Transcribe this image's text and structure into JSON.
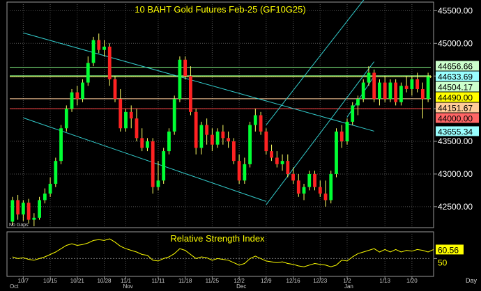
{
  "chart_data": {
    "type": "candlestick",
    "title": "10  BAHT  Gold  Futures  Feb-25  (GF10G25)",
    "indicator_title": "Relative  Strength  Index",
    "y_axis": {
      "range": [
        42200,
        45600
      ],
      "ticks": [
        {
          "value": 45500,
          "label": "45500.00"
        },
        {
          "value": 45000,
          "label": "45000.00"
        },
        {
          "value": 44500,
          "label": "44500.00"
        },
        {
          "value": 44000,
          "label": "44000.00"
        },
        {
          "value": 43500,
          "label": "43500.00"
        },
        {
          "value": 43000,
          "label": "43000.00"
        },
        {
          "value": 42500,
          "label": "42500.00"
        }
      ]
    },
    "price_tags": [
      {
        "value": 44656.66,
        "label": "44656.66",
        "bg": "#ccffcc",
        "fg": "#000000"
      },
      {
        "value": 44633.69,
        "label": "44633.69",
        "bg": "#99ffff",
        "fg": "#000000"
      },
      {
        "value": 44504.17,
        "label": "44504.17",
        "bg": "#ccffcc",
        "fg": "#000000"
      },
      {
        "value": 44490.0,
        "label": "44490.00",
        "bg": "#ffff00",
        "fg": "#000000"
      },
      {
        "value": 44151.67,
        "label": "44151.67",
        "bg": "#ffcc99",
        "fg": "#000000"
      },
      {
        "value": 44000.0,
        "label": "44000.00",
        "bg": "#ff6666",
        "fg": "#000000"
      },
      {
        "value": 43655.34,
        "label": "43655.34",
        "bg": "#99ffff",
        "fg": "#000000"
      }
    ],
    "horizontal_lines": [
      {
        "value": 44633.69,
        "color": "#88ff88"
      },
      {
        "value": 44504.17,
        "color": "#88ff88"
      },
      {
        "value": 44490.0,
        "color": "#ffff66"
      },
      {
        "value": 44151.67,
        "color": "#ffcc99"
      },
      {
        "value": 44000.0,
        "color": "#ff4444"
      }
    ],
    "trend_lines": [
      {
        "points": [
          [
            2,
            45160
          ],
          [
            67,
            43655.34
          ]
        ],
        "color": "#33cccc"
      },
      {
        "points": [
          [
            2,
            43860
          ],
          [
            47,
            42580
          ]
        ],
        "color": "#33cccc"
      },
      {
        "points": [
          [
            47,
            42530
          ],
          [
            67,
            44720
          ]
        ],
        "color": "#33cccc"
      },
      {
        "points": [
          [
            47,
            43750
          ],
          [
            67,
            45870
          ]
        ],
        "color": "#33cccc"
      },
      {
        "points": [
          [
            62,
            43870
          ],
          [
            67,
            44500
          ]
        ],
        "color": "#33cccc"
      }
    ],
    "bars": [
      {
        "date": "10/3",
        "o": 42270,
        "h": 42650,
        "l": 42220,
        "c": 42600
      },
      {
        "date": "10/4",
        "o": 42600,
        "h": 42680,
        "l": 42300,
        "c": 42380
      },
      {
        "date": "10/7",
        "o": 42380,
        "h": 42600,
        "l": 42280,
        "c": 42560
      },
      {
        "date": "10/8",
        "o": 42560,
        "h": 42620,
        "l": 42240,
        "c": 42300
      },
      {
        "date": "10/9",
        "o": 42300,
        "h": 42400,
        "l": 42200,
        "c": 42330
      },
      {
        "date": "10/10",
        "o": 42330,
        "h": 42650,
        "l": 42300,
        "c": 42600
      },
      {
        "date": "10/11",
        "o": 42600,
        "h": 42780,
        "l": 42550,
        "c": 42700
      },
      {
        "date": "10/14",
        "o": 42700,
        "h": 42950,
        "l": 42650,
        "c": 42850
      },
      {
        "date": "10/15",
        "o": 42850,
        "h": 43250,
        "l": 42800,
        "c": 43200
      },
      {
        "date": "10/16",
        "o": 43200,
        "h": 43750,
        "l": 43150,
        "c": 43700
      },
      {
        "date": "10/17",
        "o": 43700,
        "h": 44050,
        "l": 43650,
        "c": 44000
      },
      {
        "date": "10/18",
        "o": 44000,
        "h": 44300,
        "l": 43950,
        "c": 44250
      },
      {
        "date": "10/21",
        "o": 44250,
        "h": 44350,
        "l": 44050,
        "c": 44150
      },
      {
        "date": "10/22",
        "o": 44150,
        "h": 44450,
        "l": 44100,
        "c": 44400
      },
      {
        "date": "10/23",
        "o": 44400,
        "h": 44800,
        "l": 44350,
        "c": 44700
      },
      {
        "date": "10/24",
        "o": 44700,
        "h": 45100,
        "l": 44650,
        "c": 45050
      },
      {
        "date": "10/25",
        "o": 45050,
        "h": 45150,
        "l": 44850,
        "c": 44900
      },
      {
        "date": "10/28",
        "o": 44900,
        "h": 45050,
        "l": 44800,
        "c": 44950
      },
      {
        "date": "10/29",
        "o": 44950,
        "h": 45000,
        "l": 44350,
        "c": 44450
      },
      {
        "date": "10/30",
        "o": 44450,
        "h": 44500,
        "l": 44100,
        "c": 44150
      },
      {
        "date": "10/31",
        "o": 44150,
        "h": 44300,
        "l": 43650,
        "c": 43700
      },
      {
        "date": "11/1",
        "o": 43700,
        "h": 44000,
        "l": 43650,
        "c": 43950
      },
      {
        "date": "11/4",
        "o": 43950,
        "h": 44050,
        "l": 43700,
        "c": 43850
      },
      {
        "date": "11/5",
        "o": 43850,
        "h": 44000,
        "l": 43500,
        "c": 43550
      },
      {
        "date": "11/6",
        "o": 43550,
        "h": 43700,
        "l": 43350,
        "c": 43400
      },
      {
        "date": "11/7",
        "o": 43400,
        "h": 43550,
        "l": 43350,
        "c": 43500
      },
      {
        "date": "11/8",
        "o": 43500,
        "h": 43550,
        "l": 42700,
        "c": 42800
      },
      {
        "date": "11/11",
        "o": 42800,
        "h": 43200,
        "l": 42750,
        "c": 42900
      },
      {
        "date": "11/12",
        "o": 42900,
        "h": 43400,
        "l": 42850,
        "c": 43350
      },
      {
        "date": "11/13",
        "o": 43350,
        "h": 43700,
        "l": 43300,
        "c": 43650
      },
      {
        "date": "11/14",
        "o": 43650,
        "h": 44200,
        "l": 43600,
        "c": 44150
      },
      {
        "date": "11/15",
        "o": 44150,
        "h": 44800,
        "l": 44100,
        "c": 44750
      },
      {
        "date": "11/18",
        "o": 44750,
        "h": 44800,
        "l": 44450,
        "c": 44500
      },
      {
        "date": "11/19",
        "o": 44500,
        "h": 44650,
        "l": 43900,
        "c": 43950
      },
      {
        "date": "11/20",
        "o": 43950,
        "h": 44000,
        "l": 43300,
        "c": 43400
      },
      {
        "date": "11/21",
        "o": 43400,
        "h": 43800,
        "l": 43300,
        "c": 43750
      },
      {
        "date": "11/22",
        "o": 43750,
        "h": 43850,
        "l": 43450,
        "c": 43600
      },
      {
        "date": "11/25",
        "o": 43600,
        "h": 43700,
        "l": 43350,
        "c": 43450
      },
      {
        "date": "11/26",
        "o": 43450,
        "h": 43700,
        "l": 43400,
        "c": 43650
      },
      {
        "date": "11/27",
        "o": 43650,
        "h": 43750,
        "l": 43450,
        "c": 43550
      },
      {
        "date": "11/28",
        "o": 43550,
        "h": 43650,
        "l": 43400,
        "c": 43500
      },
      {
        "date": "11/29",
        "o": 43500,
        "h": 43550,
        "l": 43150,
        "c": 43200
      },
      {
        "date": "12/2",
        "o": 43200,
        "h": 43300,
        "l": 42850,
        "c": 42900
      },
      {
        "date": "12/3",
        "o": 42900,
        "h": 43250,
        "l": 42850,
        "c": 43150
      },
      {
        "date": "12/4",
        "o": 43150,
        "h": 43800,
        "l": 43100,
        "c": 43750
      },
      {
        "date": "12/5",
        "o": 43750,
        "h": 44000,
        "l": 43650,
        "c": 43900
      },
      {
        "date": "12/6",
        "o": 43900,
        "h": 43950,
        "l": 43600,
        "c": 43650
      },
      {
        "date": "12/9",
        "o": 43650,
        "h": 43700,
        "l": 43300,
        "c": 43350
      },
      {
        "date": "12/10",
        "o": 43350,
        "h": 43450,
        "l": 43200,
        "c": 43250
      },
      {
        "date": "12/11",
        "o": 43250,
        "h": 43350,
        "l": 43100,
        "c": 43150
      },
      {
        "date": "12/12",
        "o": 43150,
        "h": 43300,
        "l": 43050,
        "c": 43200
      },
      {
        "date": "12/13",
        "o": 43200,
        "h": 43300,
        "l": 42950,
        "c": 43000
      },
      {
        "date": "12/16",
        "o": 43000,
        "h": 43100,
        "l": 42850,
        "c": 42900
      },
      {
        "date": "12/17",
        "o": 42900,
        "h": 43000,
        "l": 42650,
        "c": 42700
      },
      {
        "date": "12/18",
        "o": 42700,
        "h": 42850,
        "l": 42600,
        "c": 42800
      },
      {
        "date": "12/19",
        "o": 42800,
        "h": 43050,
        "l": 42750,
        "c": 43000
      },
      {
        "date": "12/20",
        "o": 43000,
        "h": 43050,
        "l": 42750,
        "c": 42800
      },
      {
        "date": "12/23",
        "o": 42800,
        "h": 42900,
        "l": 42650,
        "c": 42700
      },
      {
        "date": "12/24",
        "o": 42700,
        "h": 42900,
        "l": 42500,
        "c": 42600
      },
      {
        "date": "12/26",
        "o": 42600,
        "h": 43050,
        "l": 42550,
        "c": 43000
      },
      {
        "date": "12/27",
        "o": 43000,
        "h": 43700,
        "l": 42950,
        "c": 43650
      },
      {
        "date": "12/30",
        "o": 43650,
        "h": 43750,
        "l": 43400,
        "c": 43500
      },
      {
        "date": "1/2",
        "o": 43500,
        "h": 43850,
        "l": 43450,
        "c": 43800
      },
      {
        "date": "1/3",
        "o": 43800,
        "h": 44100,
        "l": 43750,
        "c": 44050
      },
      {
        "date": "1/6",
        "o": 44050,
        "h": 44200,
        "l": 43900,
        "c": 44150
      },
      {
        "date": "1/7",
        "o": 44150,
        "h": 44450,
        "l": 44100,
        "c": 44400
      },
      {
        "date": "1/8",
        "o": 44400,
        "h": 44650,
        "l": 44350,
        "c": 44550
      },
      {
        "date": "1/9",
        "o": 44550,
        "h": 44600,
        "l": 44100,
        "c": 44150
      },
      {
        "date": "1/10",
        "o": 44150,
        "h": 44450,
        "l": 44050,
        "c": 44400
      },
      {
        "date": "1/13",
        "o": 44400,
        "h": 44500,
        "l": 44100,
        "c": 44150
      },
      {
        "date": "1/14",
        "o": 44150,
        "h": 44450,
        "l": 44100,
        "c": 44400
      },
      {
        "date": "1/15",
        "o": 44400,
        "h": 44450,
        "l": 44050,
        "c": 44100
      },
      {
        "date": "1/16",
        "o": 44100,
        "h": 44400,
        "l": 44050,
        "c": 44350
      },
      {
        "date": "1/17",
        "o": 44350,
        "h": 44500,
        "l": 44250,
        "c": 44300
      },
      {
        "date": "1/20",
        "o": 44300,
        "h": 44500,
        "l": 44200,
        "c": 44450
      },
      {
        "date": "1/21",
        "o": 44450,
        "h": 44550,
        "l": 44250,
        "c": 44300
      },
      {
        "date": "1/22",
        "o": 44300,
        "h": 44400,
        "l": 43850,
        "c": 44150
      },
      {
        "date": "1/23",
        "o": 44150,
        "h": 44550,
        "l": 44100,
        "c": 44500
      }
    ],
    "x_ticks": [
      {
        "index": 2,
        "label": "10/7"
      },
      {
        "index": 7,
        "label": "10/15"
      },
      {
        "index": 12,
        "label": "10/21"
      },
      {
        "index": 17,
        "label": "10/28"
      },
      {
        "index": 21,
        "label": "11/1"
      },
      {
        "index": 27,
        "label": "11/11"
      },
      {
        "index": 32,
        "label": "11/18"
      },
      {
        "index": 37,
        "label": "11/25"
      },
      {
        "index": 42,
        "label": "12/2"
      },
      {
        "index": 47,
        "label": "12/9"
      },
      {
        "index": 52,
        "label": "12/16"
      },
      {
        "index": 57,
        "label": "12/23"
      },
      {
        "index": 62,
        "label": "1/2"
      },
      {
        "index": 69,
        "label": "1/13"
      },
      {
        "index": 74,
        "label": "1/20"
      }
    ],
    "month_labels": [
      {
        "index": 0,
        "label": "Oct"
      },
      {
        "index": 21,
        "label": "Nov"
      },
      {
        "index": 42,
        "label": "Dec"
      },
      {
        "index": 62,
        "label": "Jan"
      }
    ],
    "x_axis_unit": "Day",
    "corner_note": "No Gaps",
    "rsi": {
      "range": [
        30,
        80
      ],
      "tick": {
        "value": 50,
        "label": "50"
      },
      "last_label": "60.56",
      "values": [
        52,
        50,
        51,
        49,
        48,
        50,
        52,
        55,
        58,
        62,
        66,
        68,
        66,
        67,
        69,
        72,
        73,
        72,
        74,
        70,
        65,
        62,
        60,
        58,
        55,
        54,
        48,
        47,
        50,
        52,
        56,
        62,
        60,
        55,
        50,
        52,
        51,
        48,
        50,
        49,
        48,
        45,
        42,
        44,
        50,
        53,
        50,
        47,
        46,
        45,
        46,
        44,
        43,
        41,
        40,
        42,
        44,
        43,
        42,
        40,
        42,
        48,
        47,
        52,
        56,
        58,
        60,
        62,
        58,
        61,
        58,
        61,
        58,
        60,
        59,
        61,
        60,
        58,
        61
      ]
    }
  }
}
